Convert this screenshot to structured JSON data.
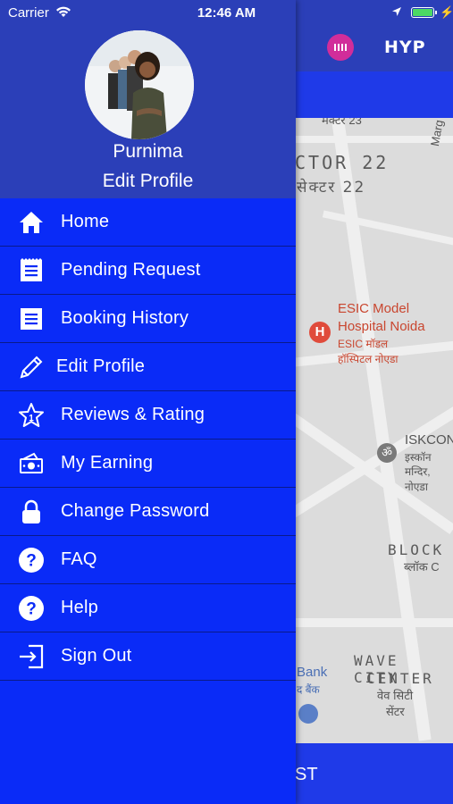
{
  "status_bar": {
    "carrier": "Carrier",
    "time": "12:46 AM"
  },
  "app": {
    "logo_text": "HYP",
    "bottom_label": "ST",
    "colors": {
      "header": "#2b3fb8",
      "accent_blue": "#1f3ae8",
      "toggle_on": "#4cd964"
    },
    "toggle_on": true
  },
  "map": {
    "sector_en": "CTOR 22",
    "sector_hi": "सेक्टर 22",
    "marg": "Marg",
    "poi_line1": "ESIC Model",
    "poi_line2": "Hospital Noida",
    "poi_hi_line1": "ESIC मॉडल",
    "poi_hi_line2": "हॉस्पिटल नोएडा",
    "iskcon": "ISKCON",
    "iskcon_hi1": "इस्कॉन",
    "iskcon_hi2": "मन्दिर, नोएडा",
    "block": "BLOCK",
    "block_hi": "ब्लॉक C",
    "wave1": "WAVE CITY",
    "wave2": "CENTER",
    "wave_hi1": "वेव सिटी",
    "wave_hi2": "सेंटर",
    "bank": "Bank",
    "bank_hi": "द बैंक",
    "top_hi": "मेक्टर 23"
  },
  "drawer": {
    "user_name": "Purnima",
    "edit_profile": "Edit Profile",
    "bg_color": "#0a2bf7",
    "items": [
      {
        "label": "Home",
        "icon": "home-icon"
      },
      {
        "label": "Pending Request",
        "icon": "receipt-icon"
      },
      {
        "label": "Booking History",
        "icon": "receipt-icon"
      },
      {
        "label": "Edit Profile",
        "icon": "pencil-icon"
      },
      {
        "label": "Reviews & Rating",
        "icon": "star-icon"
      },
      {
        "label": "My Earning",
        "icon": "money-icon"
      },
      {
        "label": "Change Password",
        "icon": "lock-icon"
      },
      {
        "label": "FAQ",
        "icon": "question-icon"
      },
      {
        "label": "Help",
        "icon": "question-icon"
      },
      {
        "label": "Sign Out",
        "icon": "sign-out-icon"
      }
    ]
  }
}
